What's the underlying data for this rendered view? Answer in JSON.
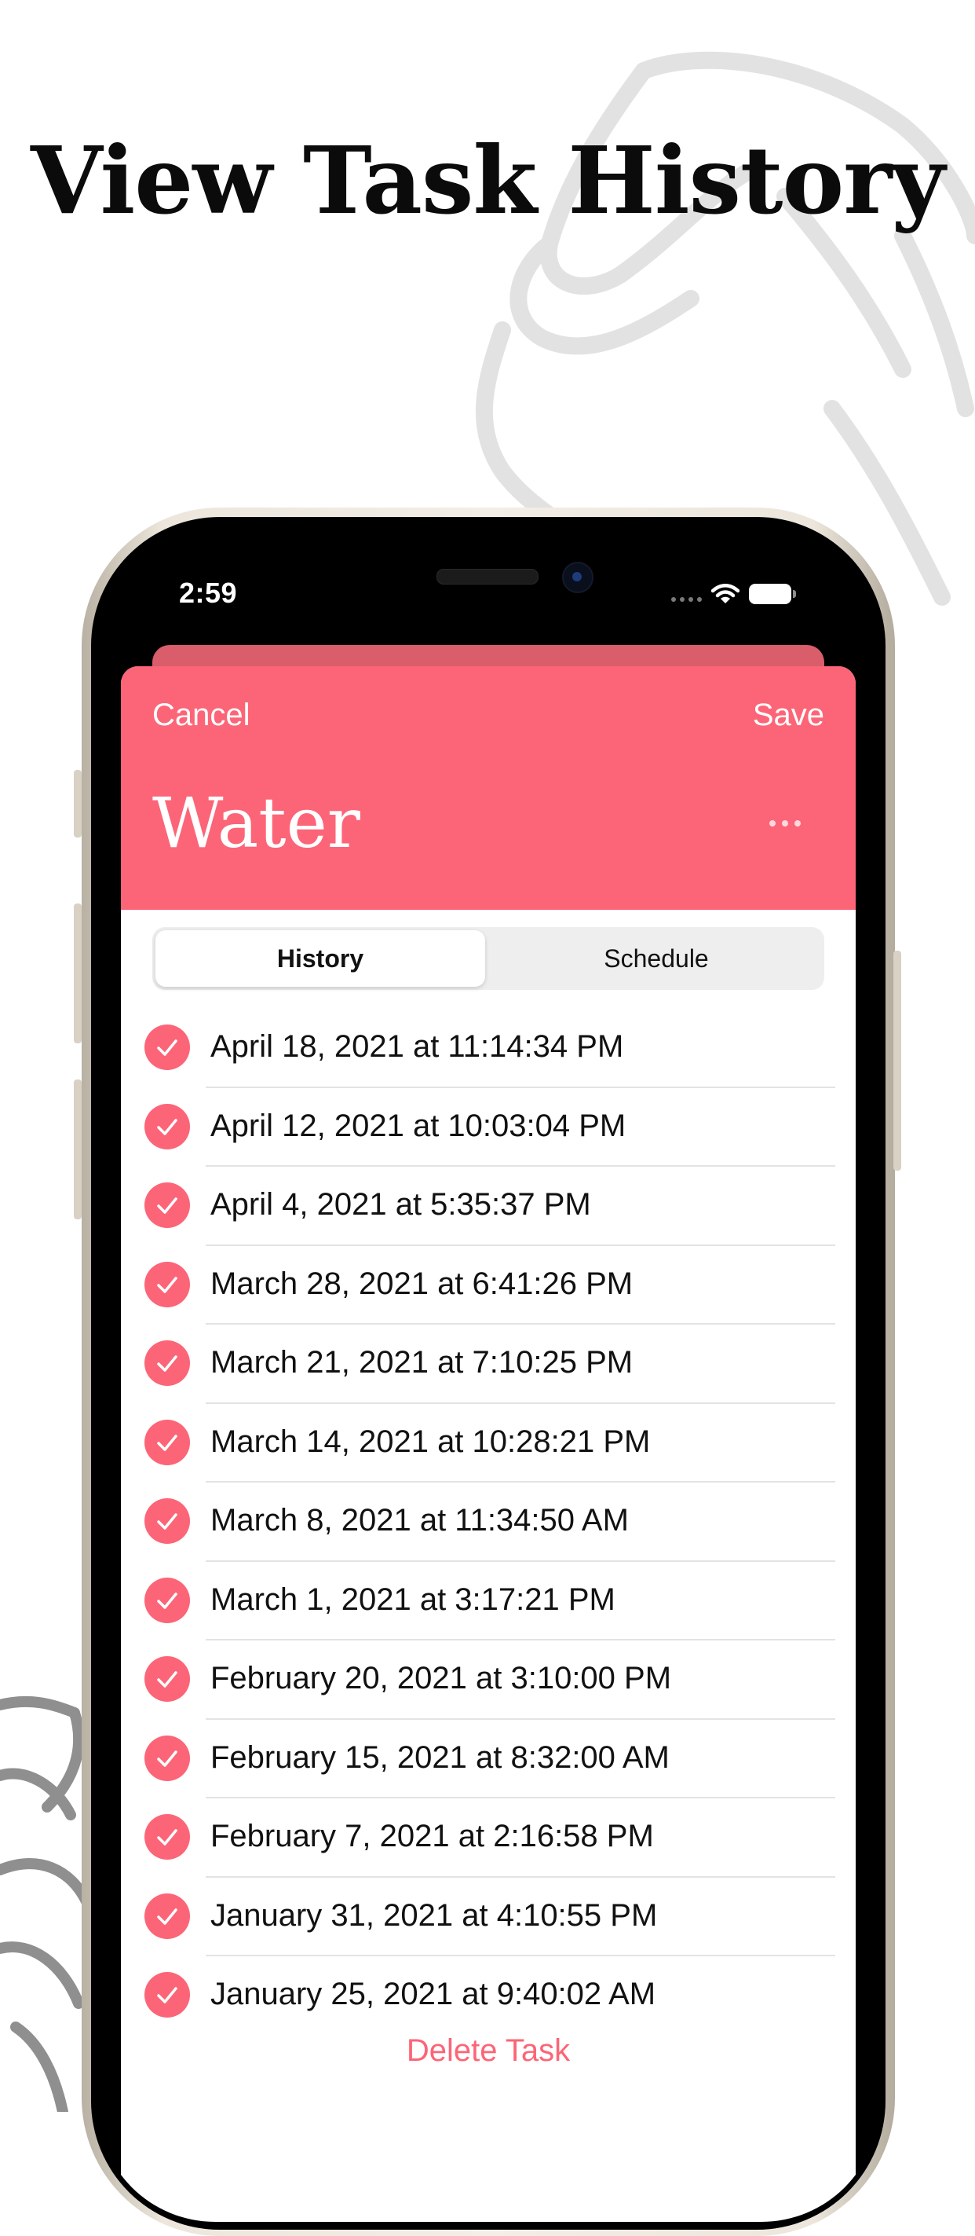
{
  "headline": "View Task History",
  "status_bar": {
    "time": "2:59"
  },
  "sheet": {
    "cancel_label": "Cancel",
    "save_label": "Save",
    "task_title": "Water",
    "accent_color": "#fc6577"
  },
  "segments": {
    "history_label": "History",
    "schedule_label": "Schedule",
    "selected": "History"
  },
  "history": [
    "April 18, 2021 at 11:14:34 PM",
    "April 12, 2021 at 10:03:04 PM",
    "April 4, 2021 at 5:35:37 PM",
    "March 28, 2021 at 6:41:26 PM",
    "March 21, 2021 at 7:10:25 PM",
    "March 14, 2021 at 10:28:21 PM",
    "March 8, 2021 at 11:34:50 AM",
    "March 1, 2021 at 3:17:21 PM",
    "February 20, 2021 at 3:10:00 PM",
    "February 15, 2021 at 8:32:00 AM",
    "February 7, 2021 at 2:16:58 PM",
    "January 31, 2021 at 4:10:55 PM",
    "January 25, 2021 at 9:40:02 AM"
  ],
  "delete_label": "Delete Task",
  "icons": {
    "check": "checkmark-circle-icon",
    "more": "ellipsis-icon",
    "wifi": "wifi-icon",
    "battery": "battery-icon"
  }
}
